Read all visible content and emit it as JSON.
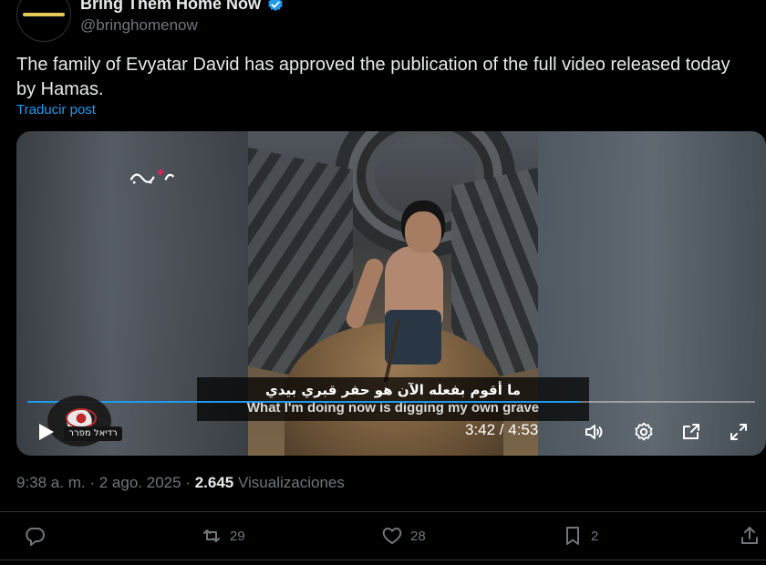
{
  "author": {
    "display_name": "Bring Them Home Now",
    "handle": "@bringhomenow",
    "verified_icon": "verified-badge-icon"
  },
  "tweet": {
    "text": "The family of Evyatar David has approved the publication of the full video released today by Hamas.",
    "translate_label": "Traducir post"
  },
  "video": {
    "subtitle_arabic": "ما أقوم بفعله الآن هو حفر قبري بيدي",
    "subtitle_english": "What I'm doing now is digging my own grave",
    "time_display": "3:42 / 4:53",
    "progress_fraction": 0.758,
    "watermark_text": "רדיאל מפרר",
    "icons": [
      "play-icon",
      "volume-icon",
      "settings-icon",
      "pip-icon",
      "fullscreen-icon"
    ]
  },
  "meta": {
    "time": "9:38 a. m.",
    "sep1": "·",
    "date": "2 ago. 2025",
    "sep2": "·",
    "views_count": "2.645",
    "views_label": "Visualizaciones"
  },
  "actions": {
    "reply": {
      "icon": "reply-icon",
      "count": ""
    },
    "repost": {
      "icon": "repost-icon",
      "count": "29"
    },
    "like": {
      "icon": "heart-icon",
      "count": "28"
    },
    "bookmark": {
      "icon": "bookmark-icon",
      "count": "2"
    },
    "share": {
      "icon": "share-icon",
      "count": ""
    }
  },
  "colors": {
    "background": "#000000",
    "text_primary": "#e7e9ea",
    "text_secondary": "#71767b",
    "accent": "#1d9bf0",
    "divider": "#2f3336"
  }
}
